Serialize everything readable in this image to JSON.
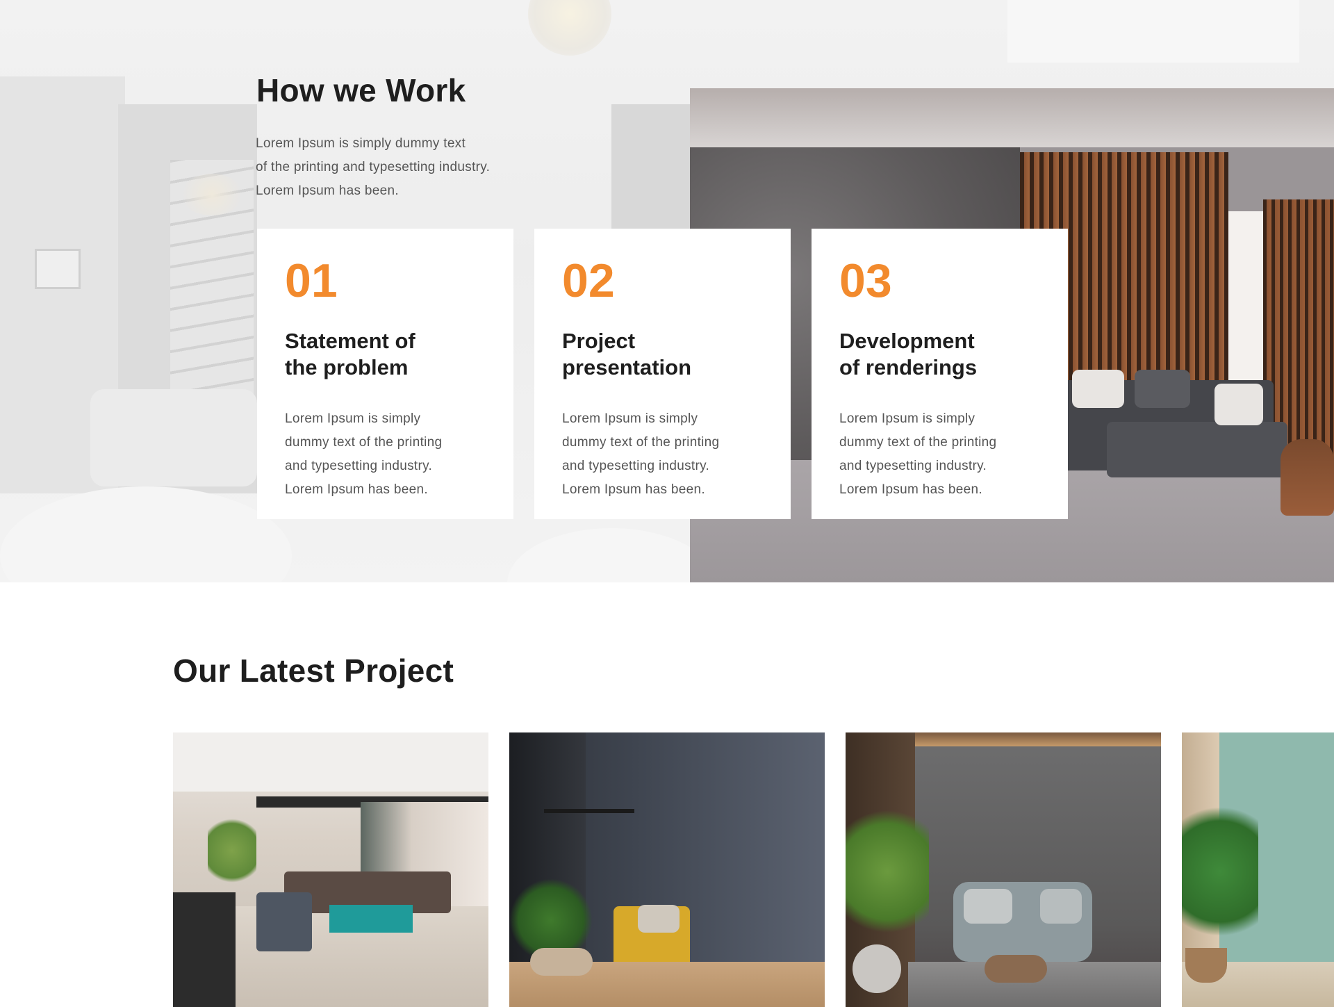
{
  "how_we_work": {
    "title": "How we Work",
    "intro_lines": [
      "Lorem Ipsum is simply dummy text",
      "of the printing and typesetting industry.",
      "Lorem Ipsum has been."
    ],
    "accent_color": "#f28a2d",
    "steps": [
      {
        "number": "01",
        "title_lines": [
          "Statement of",
          "the problem"
        ],
        "desc_lines": [
          "Lorem Ipsum is simply",
          "dummy text of the printing",
          "and typesetting industry.",
          "Lorem Ipsum has been."
        ]
      },
      {
        "number": "02",
        "title_lines": [
          "Project",
          "presentation"
        ],
        "desc_lines": [
          "Lorem Ipsum is simply",
          "dummy text of the printing",
          "and typesetting industry.",
          "Lorem Ipsum has been."
        ]
      },
      {
        "number": "03",
        "title_lines": [
          "Development",
          "of renderings"
        ],
        "desc_lines": [
          "Lorem Ipsum is simply",
          "dummy text of the printing",
          "and typesetting industry.",
          "Lorem Ipsum has been."
        ]
      }
    ]
  },
  "latest_projects": {
    "title": "Our Latest Project"
  }
}
